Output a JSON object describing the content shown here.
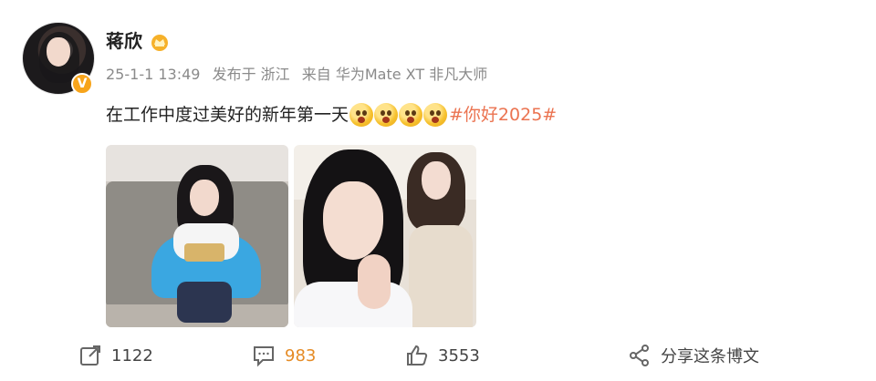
{
  "post": {
    "author": {
      "name": "蒋欣",
      "verified_badge": "V",
      "badge_color": "#f7a41b",
      "crown_icon": "crown-icon"
    },
    "meta": {
      "date": "25-1-1 13:49",
      "location": "发布于 浙江",
      "source": "来自 华为Mate XT 非凡大师"
    },
    "content": {
      "text": "在工作中度过美好的新年第一天",
      "emoji_count": 4,
      "hashtag": "#你好2025#",
      "hashtag_color": "#eb7350"
    },
    "images": [
      {
        "name": "photo-eating"
      },
      {
        "name": "photo-selfie"
      }
    ]
  },
  "actions": {
    "repost": {
      "icon": "repost-icon",
      "count": "1122"
    },
    "comment": {
      "icon": "comment-icon",
      "count": "983",
      "color": "#e58b25"
    },
    "like": {
      "icon": "thumbs-up-icon",
      "count": "3553"
    },
    "share": {
      "icon": "share-icon",
      "label": "分享这条博文"
    }
  }
}
